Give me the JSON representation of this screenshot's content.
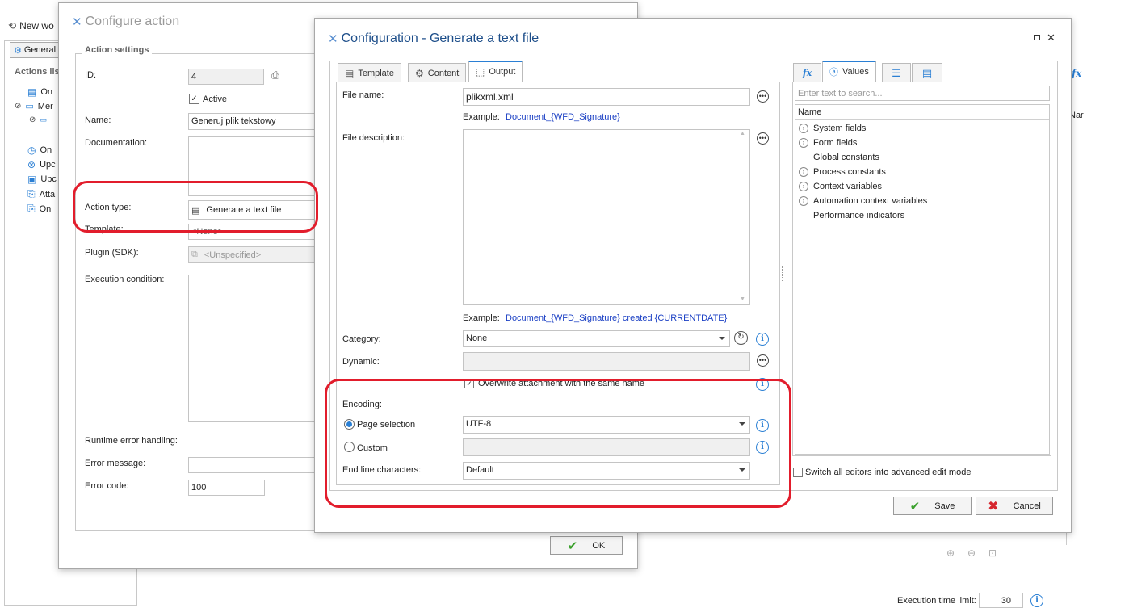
{
  "background": {
    "new_workflow_label": "New wo",
    "general_tab": "General",
    "actions_list_label": "Actions lis",
    "tree_items": [
      "On",
      "Mer",
      "",
      "On",
      "Upc",
      "Upc",
      "Atta",
      "On"
    ],
    "right_column_labels": [
      "Nar"
    ],
    "execution_time_limit_label": "Execution time limit:",
    "execution_time_limit_value": "30"
  },
  "configure_action": {
    "title": "Configure action",
    "section_label": "Action settings",
    "id_label": "ID:",
    "id_value": "4",
    "active_label": "Active",
    "name_label": "Name:",
    "name_value": "Generuj plik tekstowy",
    "documentation_label": "Documentation:",
    "action_type_label": "Action type:",
    "action_type_value": "Generate a text file",
    "template_label": "Template:",
    "template_value": "<None>",
    "plugin_label": "Plugin (SDK):",
    "plugin_value": "<Unspecified>",
    "execution_condition_label": "Execution condition:",
    "runtime_error_label": "Runtime error handling:",
    "error_message_label": "Error message:",
    "error_code_label": "Error code:",
    "error_code_value": "100",
    "ok_label": "OK"
  },
  "configuration": {
    "title": "Configuration - Generate a text file",
    "tabs": [
      {
        "label": "Template",
        "icon": "document-icon"
      },
      {
        "label": "Content",
        "icon": "content-icon"
      },
      {
        "label": "Output",
        "icon": "output-icon"
      }
    ],
    "file_name_label": "File name:",
    "file_name_value": "plikxml.xml",
    "example_label": "Example:",
    "file_name_example": "Document_{WFD_Signature}",
    "file_description_label": "File description:",
    "file_description_example": "Document_{WFD_Signature} created {CURRENTDATE}",
    "category_label": "Category:",
    "category_value": "None",
    "dynamic_label": "Dynamic:",
    "overwrite_label": "Overwrite attachment with the same name",
    "encoding_label": "Encoding:",
    "page_selection_label": "Page selection",
    "page_selection_value": "UTF-8",
    "custom_label": "Custom",
    "end_line_label": "End line characters:",
    "end_line_value": "Default",
    "side_tabs": [
      {
        "label": "fx",
        "icon": "function-icon"
      },
      {
        "label": "Values",
        "icon": "values-icon"
      },
      {
        "label": "",
        "icon": "list-icon"
      },
      {
        "label": "",
        "icon": "form-icon"
      }
    ],
    "search_placeholder": "Enter text to search...",
    "tree_header": "Name",
    "tree_items": [
      {
        "label": "System fields",
        "expandable": true
      },
      {
        "label": "Form fields",
        "expandable": true
      },
      {
        "label": "Global constants",
        "expandable": false
      },
      {
        "label": "Process constants",
        "expandable": true
      },
      {
        "label": "Context variables",
        "expandable": true
      },
      {
        "label": "Automation context variables",
        "expandable": true
      },
      {
        "label": "Performance indicators",
        "expandable": false
      }
    ],
    "advanced_mode_label": "Switch all editors into advanced edit mode",
    "save_label": "Save",
    "cancel_label": "Cancel"
  },
  "colors": {
    "accent": "#2a7fd4",
    "highlight_ring": "#e21d2c",
    "link": "#1a3fc4",
    "save_check": "#3aa02c",
    "cancel_x": "#d6262e"
  }
}
